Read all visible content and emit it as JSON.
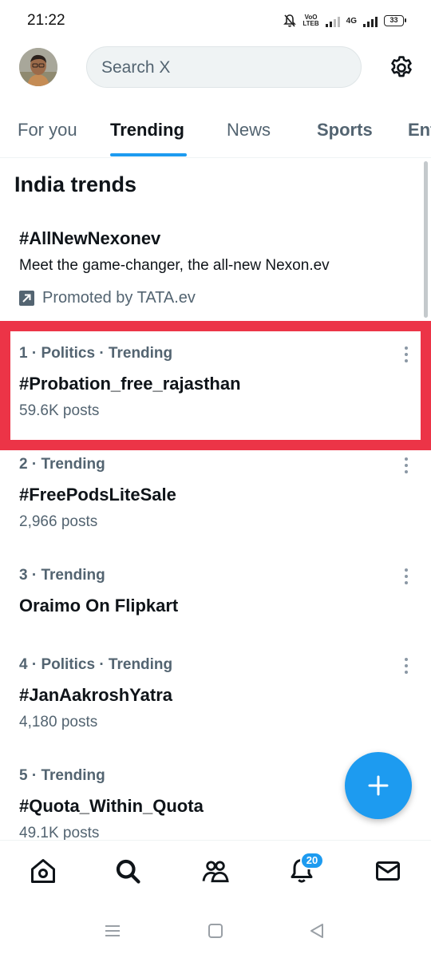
{
  "status_bar": {
    "time": "21:22",
    "network_label_top": "VoO",
    "network_label_bottom": "LTEB",
    "network_type": "4G",
    "battery": "33"
  },
  "header": {
    "search_placeholder": "Search X",
    "avatar_icon": "user-avatar",
    "settings_icon": "gear-icon"
  },
  "tabs": [
    {
      "label": "For you",
      "active": false
    },
    {
      "label": "Trending",
      "active": true
    },
    {
      "label": "News",
      "active": false
    },
    {
      "label": "Sports",
      "active": false
    },
    {
      "label": "Ent",
      "active": false
    }
  ],
  "section_title": "India trends",
  "promoted": {
    "title": "#AllNewNexonev",
    "description": "Meet the game-changer, the all-new Nexon.ev",
    "promoted_by": "Promoted by TATA.ev"
  },
  "trends": [
    {
      "rank": "1",
      "meta": " · Politics · Trending",
      "name": "#Probation_free_rajasthan",
      "posts": "59.6K posts"
    },
    {
      "rank": "2",
      "meta": " · Trending",
      "name": "#FreePodsLiteSale",
      "posts": "2,966 posts"
    },
    {
      "rank": "3",
      "meta": " · Trending",
      "name": "Oraimo On Flipkart",
      "posts": ""
    },
    {
      "rank": "4",
      "meta": " · Politics · Trending",
      "name": "#JanAakroshYatra",
      "posts": "4,180 posts"
    },
    {
      "rank": "5",
      "meta": " · Trending",
      "name": "#Quota_Within_Quota",
      "posts": "49.1K posts"
    }
  ],
  "bottom_nav": {
    "items": [
      "home-icon",
      "search-icon",
      "communities-icon",
      "notifications-icon",
      "messages-icon"
    ],
    "notification_count": "20"
  },
  "colors": {
    "accent": "#1d9bf0",
    "highlight": "#ec3447",
    "secondary_text": "#536471",
    "primary_text": "#0f1419"
  }
}
